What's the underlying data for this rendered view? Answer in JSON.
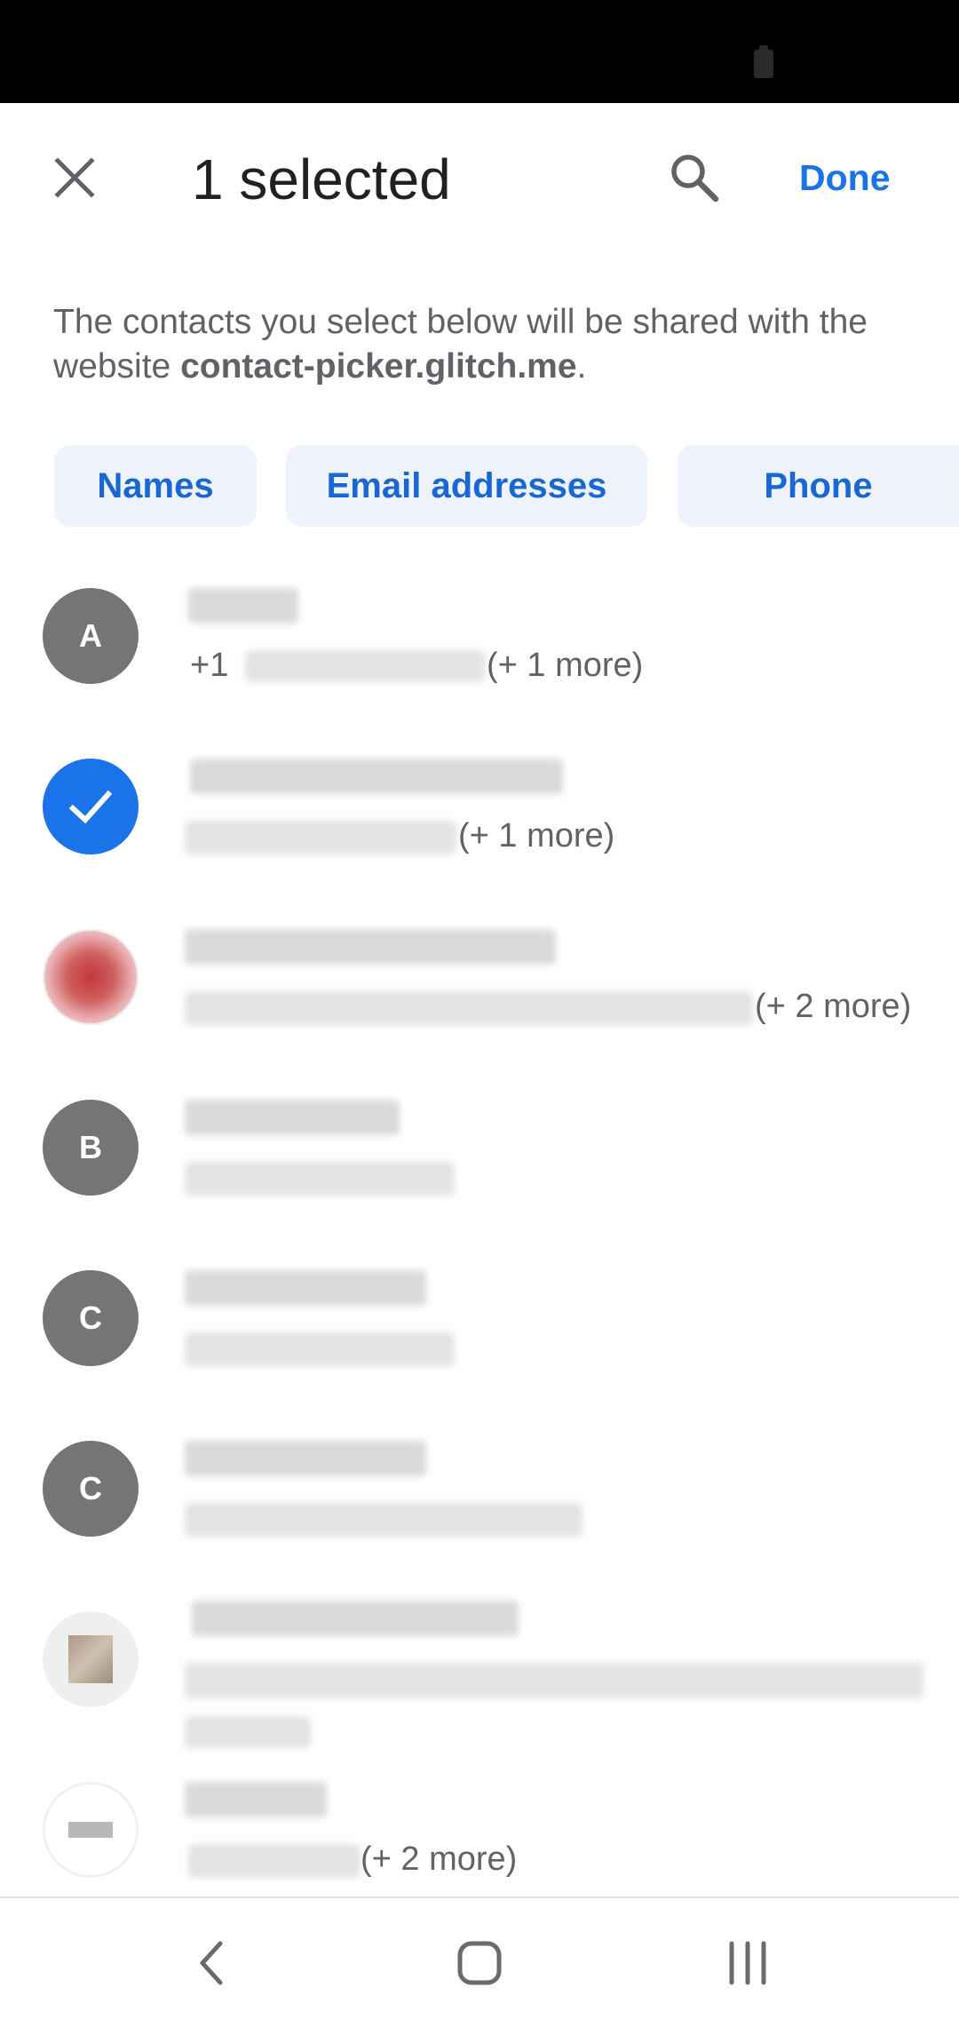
{
  "header": {
    "title": "1 selected",
    "done_label": "Done"
  },
  "description": {
    "text_before": "The contacts you select below will be shared with the website ",
    "site": "contact-picker.glitch.me",
    "text_after": "."
  },
  "chips": {
    "names": "Names",
    "email": "Email addresses",
    "phone": "Phone"
  },
  "contacts": [
    {
      "avatar_letter": "A",
      "prefix": "+1",
      "more": "(+ 1 more)"
    },
    {
      "selected": true,
      "more": "(+ 1 more)"
    },
    {
      "avatar": "photo",
      "more": "(+ 2 more)"
    },
    {
      "avatar_letter": "B"
    },
    {
      "avatar_letter": "C"
    },
    {
      "avatar_letter": "C"
    },
    {
      "avatar": "photo"
    },
    {
      "avatar": "photo",
      "more": "(+ 2 more)"
    }
  ],
  "colors": {
    "accent": "#1a73e8",
    "chip_background": "#eef3fb",
    "avatar_gray": "#757575",
    "status_bar": "#000000"
  },
  "icons": {
    "close": "close-icon",
    "search": "search-icon",
    "check": "check-icon",
    "back": "back-icon",
    "home": "home-icon",
    "recents": "recents-icon",
    "battery": "battery-icon"
  }
}
